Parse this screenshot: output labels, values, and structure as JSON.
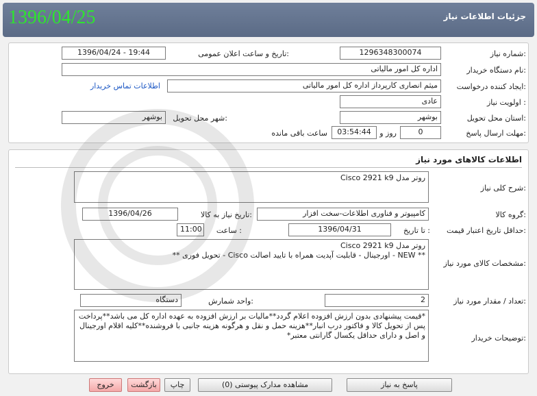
{
  "header": {
    "title": "جزئیات اطلاعات نیاز",
    "date": "1396/04/25"
  },
  "info": {
    "need_number_label": "شماره نیاز:",
    "need_number": "1296348300074",
    "announce_label": "تاریخ و ساعت اعلان عمومی:",
    "announce_value": "1396/04/24 - 19:44",
    "buyer_org_label": "نام دستگاه خریدار:",
    "buyer_org": "اداره کل امور مالیاتی",
    "requester_label": "ایجاد کننده درخواست:",
    "requester": "میثم انصاری کارپرداز اداره کل امور مالیاتی",
    "contact_link": "اطلاعات تماس خریدار",
    "priority_label": "اولویت نیاز :",
    "priority": "عادی",
    "province_label": "استان محل تحویل:",
    "province": "بوشهر",
    "city_label": "شهر محل تحویل:",
    "city": "بوشهر",
    "deadline_label": "مهلت ارسال پاسخ:",
    "days": "0",
    "days_word": "روز و",
    "time_left": "03:54:44",
    "time_left_label": "ساعت باقی مانده"
  },
  "goods": {
    "section_title": "اطلاعات کالاهای مورد نیاز",
    "desc_label": "شرح کلی نیاز:",
    "desc": "روتر مدل Cisco 2921 k9",
    "group_label": "گروه کالا:",
    "group": "کامپیوتر و فناوری اطلاعات-سخت افزار",
    "need_date_label": "تاریخ نیاز به کالا:",
    "need_date": "1396/04/26",
    "validity_label": "حداقل تاریخ اعتبار قیمت:",
    "until_label": "تا تاریخ :",
    "validity_date": "1396/04/31",
    "time_label": "ساعت :",
    "validity_time": "11:00",
    "spec_label": "مشخصات کالای مورد نیاز:",
    "spec_line1": "روتر مدل Cisco 2921 k9",
    "spec_line2": "** NEW - اورجینال - قابلیت آپدیت همراه با تایید اصالت Cisco - تحویل فوری **",
    "qty_label": "تعداد / مقدار مورد نیاز:",
    "qty": "2",
    "unit_label": "واحد شمارش:",
    "unit": "دستگاه",
    "buyer_notes_label": "توضیحات خریدار:",
    "buyer_notes": "*قیمت پیشنهادی بدون ارزش افزوده اعلام گردد**مالیات بر ارزش افزوده به عهده اداره کل می باشد**پرداخت پس از تحویل کالا و فاکتور درب انبار**هزینه حمل و نقل و هرگونه هزینه جانبی با فروشنده**کلیه اقلام اورجینال و اصل و دارای حداقل یکسال گارانتی معتبر*"
  },
  "buttons": {
    "respond": "پاسخ به نیاز",
    "attachments": "مشاهده مدارک پیوستی (0)",
    "print": "چاپ",
    "back": "بازگشت",
    "exit": "خروج"
  }
}
